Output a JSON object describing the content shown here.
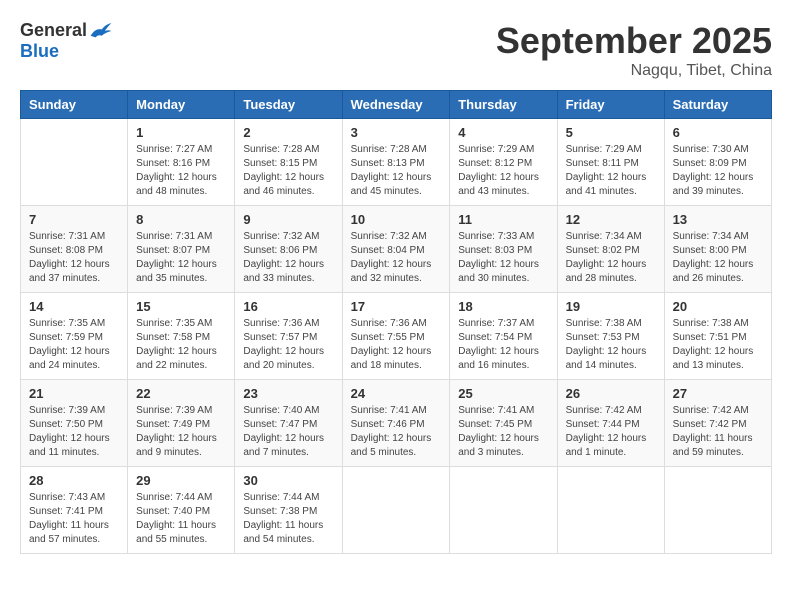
{
  "logo": {
    "general": "General",
    "blue": "Blue"
  },
  "header": {
    "month": "September 2025",
    "location": "Nagqu, Tibet, China"
  },
  "weekdays": [
    "Sunday",
    "Monday",
    "Tuesday",
    "Wednesday",
    "Thursday",
    "Friday",
    "Saturday"
  ],
  "weeks": [
    [
      {
        "day": "",
        "sunrise": "",
        "sunset": "",
        "daylight": ""
      },
      {
        "day": "1",
        "sunrise": "Sunrise: 7:27 AM",
        "sunset": "Sunset: 8:16 PM",
        "daylight": "Daylight: 12 hours and 48 minutes."
      },
      {
        "day": "2",
        "sunrise": "Sunrise: 7:28 AM",
        "sunset": "Sunset: 8:15 PM",
        "daylight": "Daylight: 12 hours and 46 minutes."
      },
      {
        "day": "3",
        "sunrise": "Sunrise: 7:28 AM",
        "sunset": "Sunset: 8:13 PM",
        "daylight": "Daylight: 12 hours and 45 minutes."
      },
      {
        "day": "4",
        "sunrise": "Sunrise: 7:29 AM",
        "sunset": "Sunset: 8:12 PM",
        "daylight": "Daylight: 12 hours and 43 minutes."
      },
      {
        "day": "5",
        "sunrise": "Sunrise: 7:29 AM",
        "sunset": "Sunset: 8:11 PM",
        "daylight": "Daylight: 12 hours and 41 minutes."
      },
      {
        "day": "6",
        "sunrise": "Sunrise: 7:30 AM",
        "sunset": "Sunset: 8:09 PM",
        "daylight": "Daylight: 12 hours and 39 minutes."
      }
    ],
    [
      {
        "day": "7",
        "sunrise": "Sunrise: 7:31 AM",
        "sunset": "Sunset: 8:08 PM",
        "daylight": "Daylight: 12 hours and 37 minutes."
      },
      {
        "day": "8",
        "sunrise": "Sunrise: 7:31 AM",
        "sunset": "Sunset: 8:07 PM",
        "daylight": "Daylight: 12 hours and 35 minutes."
      },
      {
        "day": "9",
        "sunrise": "Sunrise: 7:32 AM",
        "sunset": "Sunset: 8:06 PM",
        "daylight": "Daylight: 12 hours and 33 minutes."
      },
      {
        "day": "10",
        "sunrise": "Sunrise: 7:32 AM",
        "sunset": "Sunset: 8:04 PM",
        "daylight": "Daylight: 12 hours and 32 minutes."
      },
      {
        "day": "11",
        "sunrise": "Sunrise: 7:33 AM",
        "sunset": "Sunset: 8:03 PM",
        "daylight": "Daylight: 12 hours and 30 minutes."
      },
      {
        "day": "12",
        "sunrise": "Sunrise: 7:34 AM",
        "sunset": "Sunset: 8:02 PM",
        "daylight": "Daylight: 12 hours and 28 minutes."
      },
      {
        "day": "13",
        "sunrise": "Sunrise: 7:34 AM",
        "sunset": "Sunset: 8:00 PM",
        "daylight": "Daylight: 12 hours and 26 minutes."
      }
    ],
    [
      {
        "day": "14",
        "sunrise": "Sunrise: 7:35 AM",
        "sunset": "Sunset: 7:59 PM",
        "daylight": "Daylight: 12 hours and 24 minutes."
      },
      {
        "day": "15",
        "sunrise": "Sunrise: 7:35 AM",
        "sunset": "Sunset: 7:58 PM",
        "daylight": "Daylight: 12 hours and 22 minutes."
      },
      {
        "day": "16",
        "sunrise": "Sunrise: 7:36 AM",
        "sunset": "Sunset: 7:57 PM",
        "daylight": "Daylight: 12 hours and 20 minutes."
      },
      {
        "day": "17",
        "sunrise": "Sunrise: 7:36 AM",
        "sunset": "Sunset: 7:55 PM",
        "daylight": "Daylight: 12 hours and 18 minutes."
      },
      {
        "day": "18",
        "sunrise": "Sunrise: 7:37 AM",
        "sunset": "Sunset: 7:54 PM",
        "daylight": "Daylight: 12 hours and 16 minutes."
      },
      {
        "day": "19",
        "sunrise": "Sunrise: 7:38 AM",
        "sunset": "Sunset: 7:53 PM",
        "daylight": "Daylight: 12 hours and 14 minutes."
      },
      {
        "day": "20",
        "sunrise": "Sunrise: 7:38 AM",
        "sunset": "Sunset: 7:51 PM",
        "daylight": "Daylight: 12 hours and 13 minutes."
      }
    ],
    [
      {
        "day": "21",
        "sunrise": "Sunrise: 7:39 AM",
        "sunset": "Sunset: 7:50 PM",
        "daylight": "Daylight: 12 hours and 11 minutes."
      },
      {
        "day": "22",
        "sunrise": "Sunrise: 7:39 AM",
        "sunset": "Sunset: 7:49 PM",
        "daylight": "Daylight: 12 hours and 9 minutes."
      },
      {
        "day": "23",
        "sunrise": "Sunrise: 7:40 AM",
        "sunset": "Sunset: 7:47 PM",
        "daylight": "Daylight: 12 hours and 7 minutes."
      },
      {
        "day": "24",
        "sunrise": "Sunrise: 7:41 AM",
        "sunset": "Sunset: 7:46 PM",
        "daylight": "Daylight: 12 hours and 5 minutes."
      },
      {
        "day": "25",
        "sunrise": "Sunrise: 7:41 AM",
        "sunset": "Sunset: 7:45 PM",
        "daylight": "Daylight: 12 hours and 3 minutes."
      },
      {
        "day": "26",
        "sunrise": "Sunrise: 7:42 AM",
        "sunset": "Sunset: 7:44 PM",
        "daylight": "Daylight: 12 hours and 1 minute."
      },
      {
        "day": "27",
        "sunrise": "Sunrise: 7:42 AM",
        "sunset": "Sunset: 7:42 PM",
        "daylight": "Daylight: 11 hours and 59 minutes."
      }
    ],
    [
      {
        "day": "28",
        "sunrise": "Sunrise: 7:43 AM",
        "sunset": "Sunset: 7:41 PM",
        "daylight": "Daylight: 11 hours and 57 minutes."
      },
      {
        "day": "29",
        "sunrise": "Sunrise: 7:44 AM",
        "sunset": "Sunset: 7:40 PM",
        "daylight": "Daylight: 11 hours and 55 minutes."
      },
      {
        "day": "30",
        "sunrise": "Sunrise: 7:44 AM",
        "sunset": "Sunset: 7:38 PM",
        "daylight": "Daylight: 11 hours and 54 minutes."
      },
      {
        "day": "",
        "sunrise": "",
        "sunset": "",
        "daylight": ""
      },
      {
        "day": "",
        "sunrise": "",
        "sunset": "",
        "daylight": ""
      },
      {
        "day": "",
        "sunrise": "",
        "sunset": "",
        "daylight": ""
      },
      {
        "day": "",
        "sunrise": "",
        "sunset": "",
        "daylight": ""
      }
    ]
  ]
}
